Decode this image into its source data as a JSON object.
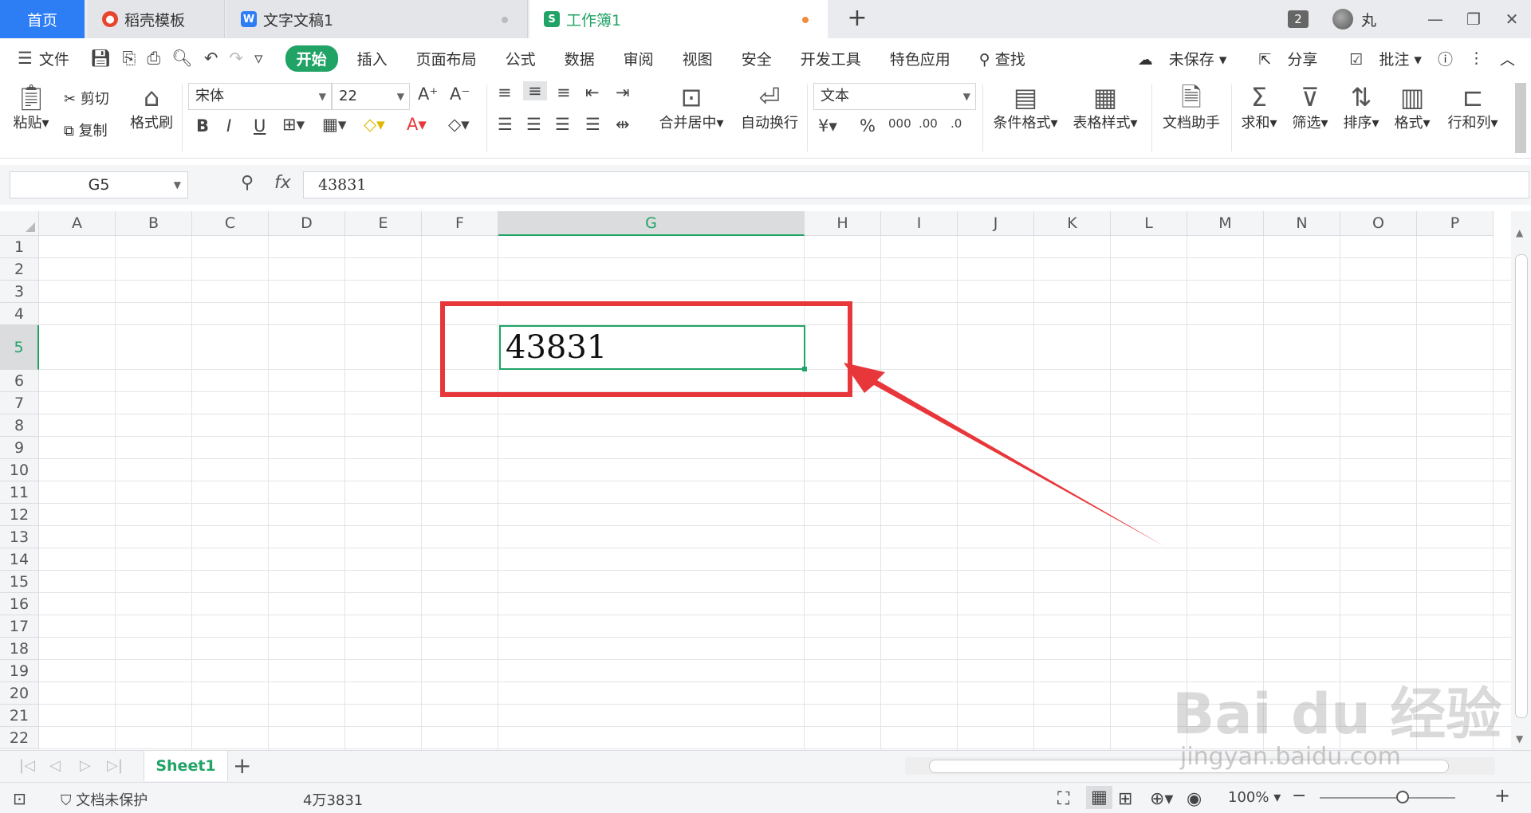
{
  "tabs": {
    "home": "首页",
    "template": "稻壳模板",
    "writer": "文字文稿1",
    "workbook": "工作簿1",
    "new_tab": "+",
    "count_badge": "2",
    "username": "丸"
  },
  "menu": {
    "file": "文件",
    "items": [
      "开始",
      "插入",
      "页面布局",
      "公式",
      "数据",
      "审阅",
      "视图",
      "安全",
      "开发工具",
      "特色应用"
    ],
    "search": "查找",
    "unsaved": "未保存",
    "share": "分享",
    "annotate": "批注"
  },
  "ribbon": {
    "paste": "粘贴",
    "cut": "剪切",
    "copy": "复制",
    "format_painter": "格式刷",
    "font_name": "宋体",
    "font_size": "22",
    "merge_center": "合并居中",
    "wrap_text": "自动换行",
    "number_format": "文本",
    "conditional_format": "条件格式",
    "table_style": "表格样式",
    "doc_assistant": "文档助手",
    "sum": "求和",
    "filter": "筛选",
    "sort": "排序",
    "format": "格式",
    "row_col": "行和列"
  },
  "formula_bar": {
    "name_box": "G5",
    "fx_label": "fx",
    "value": "43831"
  },
  "grid": {
    "columns": [
      "A",
      "B",
      "C",
      "D",
      "E",
      "F",
      "G",
      "H",
      "I",
      "J",
      "K",
      "L",
      "M",
      "N",
      "O",
      "P"
    ],
    "rows": [
      "1",
      "2",
      "3",
      "4",
      "5",
      "6",
      "7",
      "8",
      "9",
      "10",
      "11",
      "12",
      "13",
      "14",
      "15",
      "16",
      "17",
      "18",
      "19",
      "20",
      "21",
      "22"
    ],
    "selected_column": "G",
    "selected_row": "5",
    "active_cell_value": "43831"
  },
  "sheets": {
    "active": "Sheet1",
    "add": "+"
  },
  "status": {
    "protection": "文档未保护",
    "summary": "4万3831",
    "zoom": "100%"
  },
  "watermark": {
    "text": "Bai du 经验",
    "sub": "jingyan.baidu.com"
  },
  "colors": {
    "accent_green": "#21a366",
    "home_blue": "#2d7df5",
    "highlight_red": "#e8373b"
  }
}
